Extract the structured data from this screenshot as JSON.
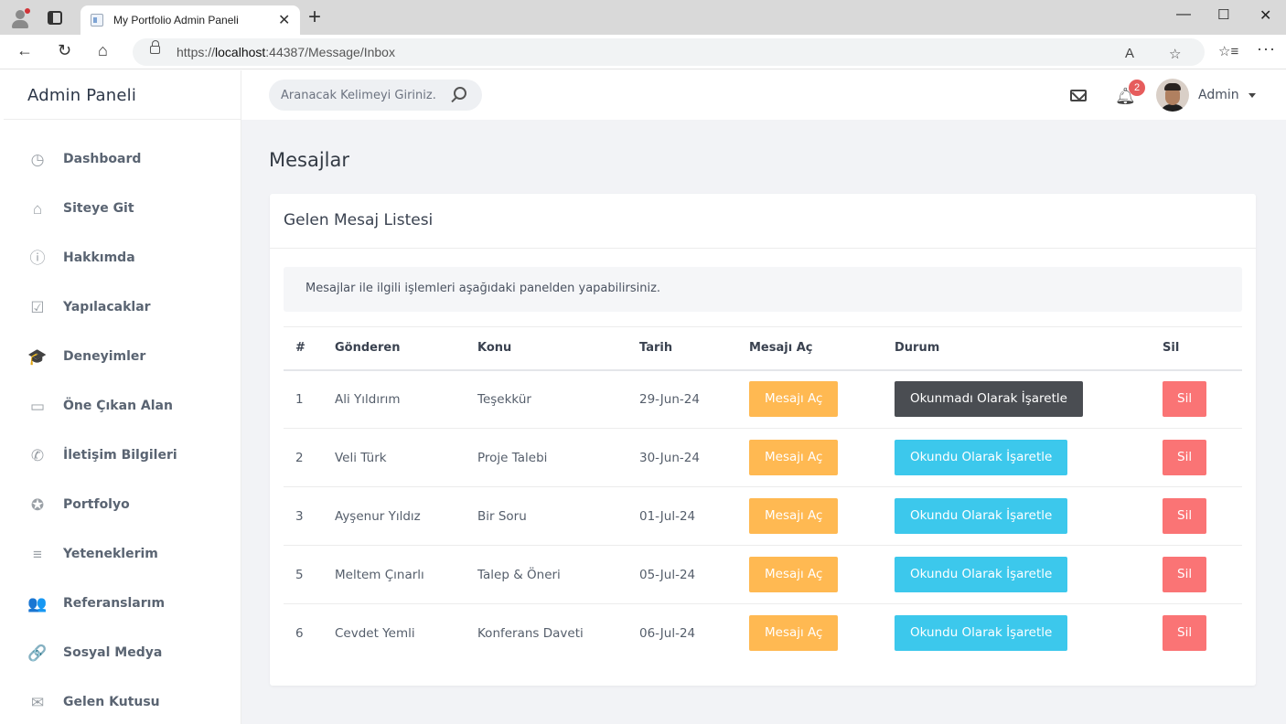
{
  "browser": {
    "tab_title": "My Portfolio Admin Paneli",
    "tab_close": "✕",
    "new_tab": "+",
    "url_prefix": "https://",
    "url_host": "localhost",
    "url_rest": ":44387/Message/Inbox",
    "window_controls": {
      "minimize": "—",
      "maximize": "☐",
      "close": "✕"
    }
  },
  "sidebar": {
    "brand": "Admin Paneli",
    "items": [
      {
        "label": "Dashboard",
        "icon": "dashboard-icon",
        "glyph": "◷"
      },
      {
        "label": "Siteye Git",
        "icon": "home-icon",
        "glyph": "⌂"
      },
      {
        "label": "Hakkımda",
        "icon": "info-icon",
        "glyph": "ⓘ"
      },
      {
        "label": "Yapılacaklar",
        "icon": "calendar-check-icon",
        "glyph": "☑"
      },
      {
        "label": "Deneyimler",
        "icon": "graduation-cap-icon",
        "glyph": "🎓"
      },
      {
        "label": "Öne Çıkan Alan",
        "icon": "monitor-icon",
        "glyph": "▭"
      },
      {
        "label": "İletişim Bilgileri",
        "icon": "whatsapp-icon",
        "glyph": "✆"
      },
      {
        "label": "Portfolyo",
        "icon": "award-icon",
        "glyph": "✪"
      },
      {
        "label": "Yeteneklerim",
        "icon": "skills-chart-icon",
        "glyph": "≡"
      },
      {
        "label": "Referanslarım",
        "icon": "users-icon",
        "glyph": "👥"
      },
      {
        "label": "Sosyal Medya",
        "icon": "link-icon",
        "glyph": "🔗"
      },
      {
        "label": "Gelen Kutusu",
        "icon": "mail-icon",
        "glyph": "✉"
      }
    ]
  },
  "topbar": {
    "search_placeholder": "Aranacak Kelimeyi Giriniz.",
    "notification_count": "2",
    "bell_glyph": "🔔",
    "user_name": "Admin"
  },
  "page": {
    "title": "Mesajlar",
    "card_title": "Gelen Mesaj Listesi",
    "info_text": "Mesajlar ile ilgili işlemleri aşağıdaki panelden yapabilirsiniz."
  },
  "table": {
    "headers": [
      "#",
      "Gönderen",
      "Konu",
      "Tarih",
      "Mesajı Aç",
      "Durum",
      "Sil"
    ],
    "rows": [
      {
        "id": "1",
        "sender": "Ali Yıldırım",
        "subject": "Teşekkür",
        "date": "29-Jun-24",
        "open": "Mesajı Aç",
        "status": "Okunmadı Olarak İşaretle",
        "status_type": "unread",
        "delete": "Sil"
      },
      {
        "id": "2",
        "sender": "Veli Türk",
        "subject": "Proje Talebi",
        "date": "30-Jun-24",
        "open": "Mesajı Aç",
        "status": "Okundu Olarak İşaretle",
        "status_type": "read",
        "delete": "Sil"
      },
      {
        "id": "3",
        "sender": "Ayşenur Yıldız",
        "subject": "Bir Soru",
        "date": "01-Jul-24",
        "open": "Mesajı Aç",
        "status": "Okundu Olarak İşaretle",
        "status_type": "read",
        "delete": "Sil"
      },
      {
        "id": "5",
        "sender": "Meltem Çınarlı",
        "subject": "Talep & Öneri",
        "date": "05-Jul-24",
        "open": "Mesajı Aç",
        "status": "Okundu Olarak İşaretle",
        "status_type": "read",
        "delete": "Sil"
      },
      {
        "id": "6",
        "sender": "Cevdet Yemli",
        "subject": "Konferans Daveti",
        "date": "06-Jul-24",
        "open": "Mesajı Aç",
        "status": "Okundu Olarak İşaretle",
        "status_type": "read",
        "delete": "Sil"
      }
    ]
  },
  "colors": {
    "open_button": "#ffb952",
    "read_button": "#3cc8ec",
    "unread_button": "#4a4d52",
    "delete_button": "#fa7475",
    "badge": "#e65c5c"
  }
}
